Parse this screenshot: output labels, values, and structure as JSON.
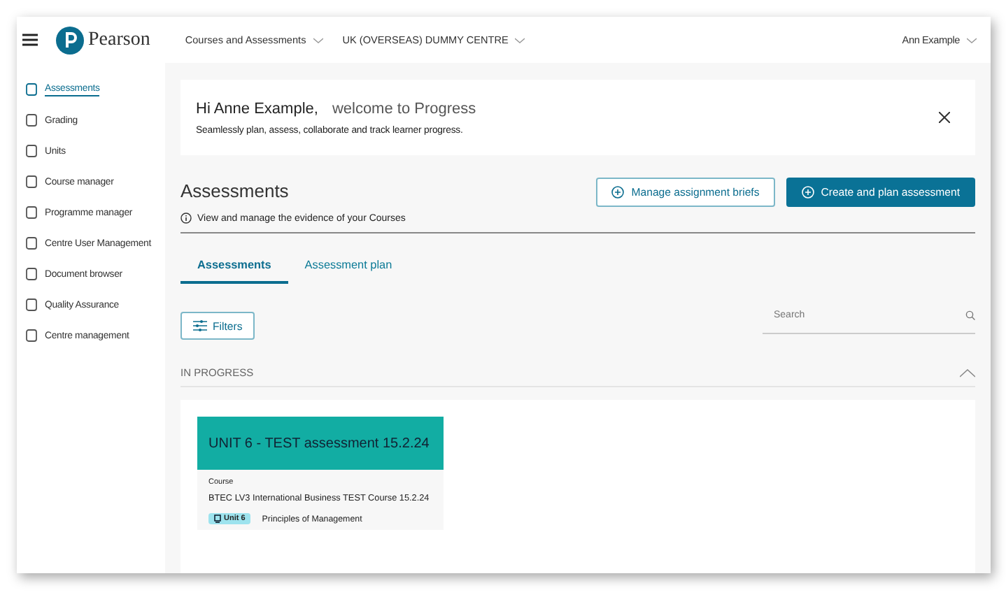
{
  "header": {
    "logo": "Pearson",
    "nav": [
      "Courses and Assessments",
      "UK (OVERSEAS) DUMMY CENTRE"
    ],
    "user": "Ann Example"
  },
  "sidebar": {
    "items": [
      {
        "label": "Assessments",
        "selected": true
      },
      {
        "label": "Grading",
        "selected": false
      },
      {
        "label": "Units",
        "selected": false
      },
      {
        "label": "Course manager",
        "selected": false
      },
      {
        "label": "Programme manager",
        "selected": false
      },
      {
        "label": "Centre User Management",
        "selected": false
      },
      {
        "label": "Document browser",
        "selected": false
      },
      {
        "label": "Quality Assurance",
        "selected": false
      },
      {
        "label": "Centre management",
        "selected": false
      }
    ]
  },
  "banner": {
    "greeting": "Hi Anne Example,",
    "welcome": "welcome to Progress",
    "subtitle": "Seamlessly plan, assess, collaborate and track learner progress."
  },
  "page": {
    "title": "Assessments",
    "info": "View and manage the evidence of your Courses",
    "buttons": [
      {
        "label": "Manage assignment briefs",
        "kind": "outline"
      },
      {
        "label": "Create and plan assessment",
        "kind": "primary"
      }
    ]
  },
  "tabs": [
    {
      "label": "Assessments",
      "selected": true
    },
    {
      "label": "Assessment plan",
      "selected": false
    }
  ],
  "filters": {
    "label": "Filters"
  },
  "search": {
    "placeholder": "Search"
  },
  "section": {
    "title": "IN PROGRESS",
    "expanded": true,
    "cards": [
      {
        "title": "UNIT 6 - TEST assessment 15.2.24",
        "course_label": "Course",
        "course": "BTEC LV3 International Business TEST Course 15.2.24",
        "unit_tag": "Unit 6",
        "unit_name": "Principles of Management"
      }
    ]
  }
}
